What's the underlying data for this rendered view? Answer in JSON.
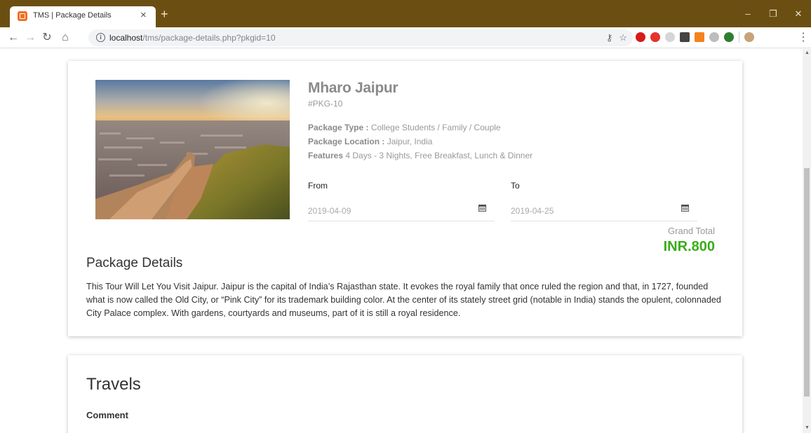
{
  "browser": {
    "tab_title": "TMS | Package Details",
    "tab_close": "×",
    "new_tab": "+",
    "url_host": "localhost",
    "url_path": "/tms/package-details.php?pkgid=10",
    "win_minimize": "–",
    "win_restore": "❐",
    "win_close": "✕"
  },
  "package": {
    "name": "Mharo Jaipur",
    "code": "#PKG-10",
    "type_label": "Package Type :",
    "type_value": " College Students / Family / Couple",
    "location_label": "Package Location :",
    "location_value": " Jaipur, India",
    "features_label": "Features",
    "features_value": " 4 Days - 3 Nights, Free Breakfast, Lunch & Dinner"
  },
  "booking": {
    "from_label": "From",
    "from_value": "2019-04-09",
    "to_label": "To",
    "to_value": "2019-04-25",
    "grand_total_label": "Grand Total",
    "grand_total_value": "INR.800"
  },
  "details": {
    "title": "Package Details",
    "text": "This Tour Will Let You Visit Jaipur. Jaipur is the capital of India’s Rajasthan state. It evokes the royal family that once ruled the region and that, in 1727, founded what is now called the Old City, or “Pink City” for its trademark building color. At the center of its stately street grid (notable in India) stands the opulent, colonnaded City Palace complex. With gardens, courtyards and museums, part of it is still a royal residence."
  },
  "travels": {
    "title": "Travels",
    "comment_label": "Comment"
  },
  "colors": {
    "chrome": "#6b4f12",
    "total_green": "#3aad1a"
  }
}
